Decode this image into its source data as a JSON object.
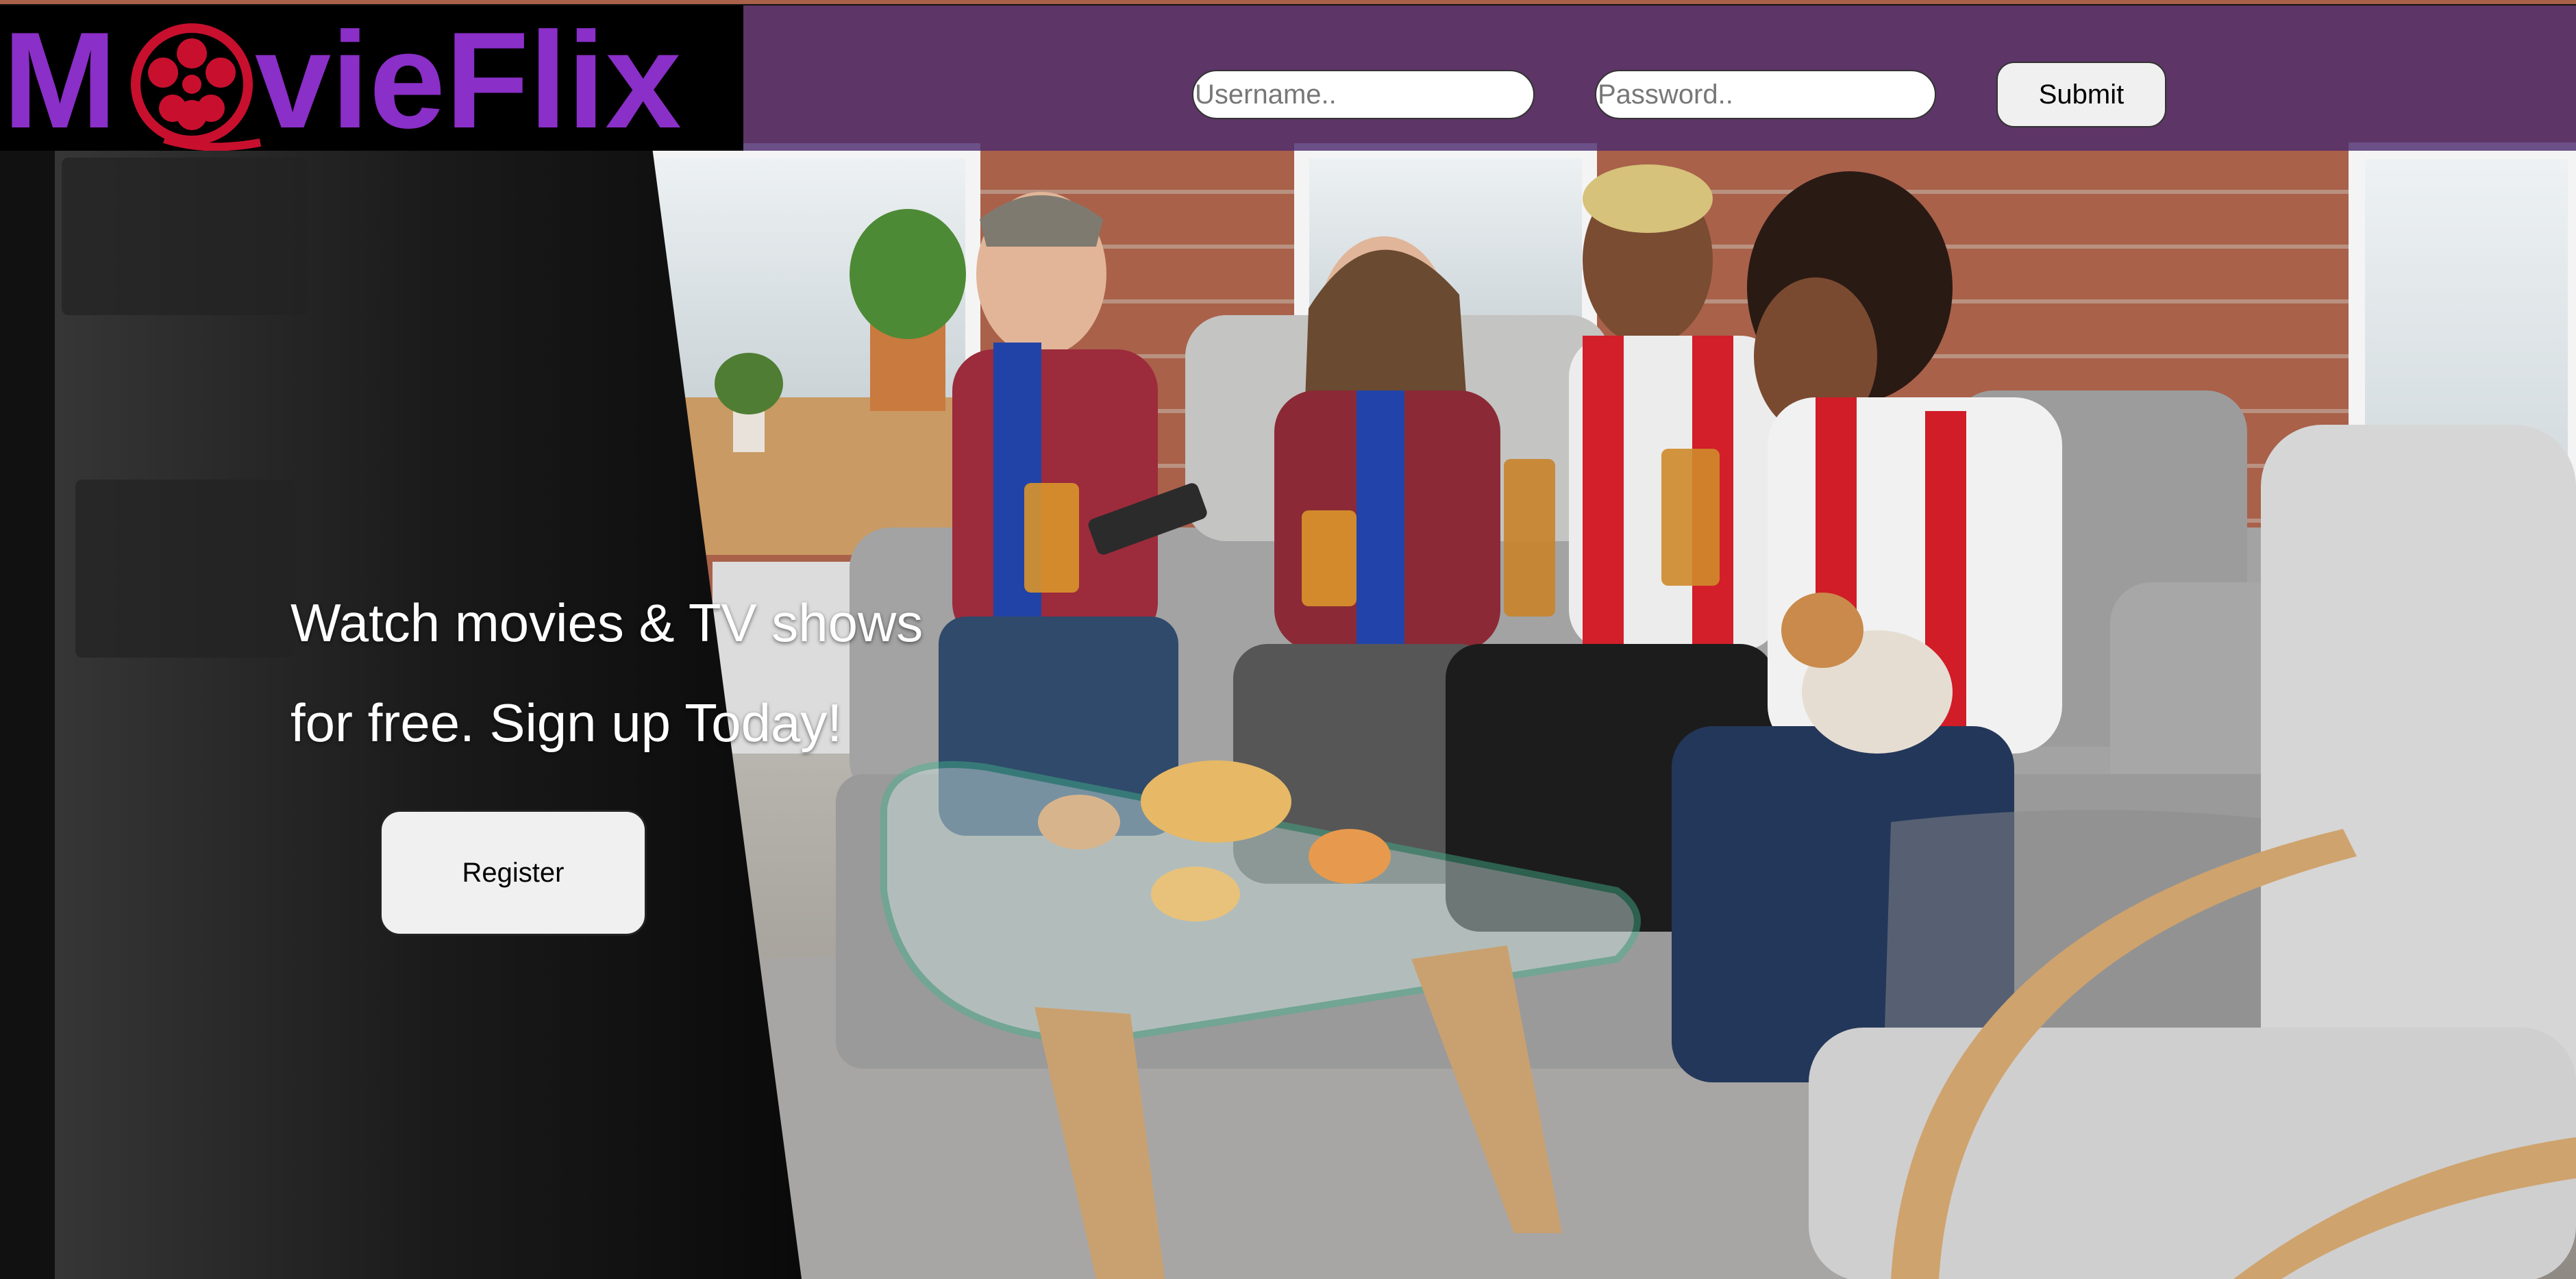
{
  "brand": {
    "name_part1": "M",
    "name_part2": "vieFlix",
    "logo_icon": "film-reel-icon",
    "colors": {
      "brand_purple": "#8a2fc7",
      "reel_red": "#c8102e",
      "header_bg": "#4c2c6e"
    }
  },
  "login": {
    "username_placeholder": "Username..",
    "password_placeholder": "Password..",
    "submit_label": "Submit"
  },
  "hero": {
    "tagline_line1": "Watch movies & TV shows",
    "tagline_line2": "for free. Sign up Today!",
    "register_label": "Register"
  }
}
